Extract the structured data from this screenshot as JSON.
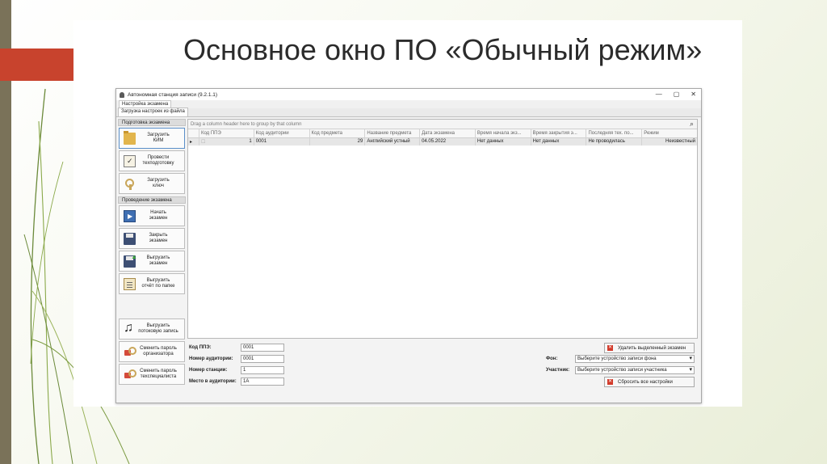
{
  "slide": {
    "title": "Основное окно ПО «Обычный режим»"
  },
  "window": {
    "title": "Автономная станция записи (9.2.1.1)",
    "controls": {
      "minimize": "—",
      "maximize": "▢",
      "close": "✕"
    },
    "menu_tab": "Настройка экзамена",
    "sub_tab": "Загрузка настроек из файла"
  },
  "left_panel": {
    "group_prepare": "Подготовка экзамена",
    "group_conduct": "Проведение экзамена",
    "buttons": {
      "load_kim": "Загрузить\nКИМ",
      "tech_prep": "Провести\nтехподготовку",
      "load_key": "Загрузить\nключ",
      "start_exam": "Начать\nэкзамен",
      "close_exam": "Закрыть\nэкзамен",
      "upload_exam": "Выгрузить\nэкзамен",
      "upload_report": "Выгрузить\nотчёт по папке",
      "upload_stream": "Выгрузить\nпотоковую запись",
      "change_org_pwd": "Сменить пароль\nорганизатора",
      "change_tech_pwd": "Сменить пароль\nтехспециалиста"
    }
  },
  "grid": {
    "group_hint": "Drag a column header here to group by that column",
    "search_icon": "⌕",
    "columns": [
      "",
      "Код ППЭ",
      "Код аудитории",
      "Код предмета",
      "Название предмета",
      "Дата экзамена",
      "Время начала экз...",
      "Время закрытия э...",
      "Последняя тех. по...",
      "Режим"
    ],
    "rows": [
      {
        "indicator": "▸",
        "check": "☐",
        "ppe_code": "1",
        "auditorium_code": "0001",
        "subject_code": "29",
        "subject_name": "Английский устный",
        "exam_date": "04.05.2022",
        "start_time": "Нет данных",
        "close_time": "Нет данных",
        "last_tech": "Не проводилась",
        "mode": "Неизвестный"
      }
    ]
  },
  "form": {
    "ppe_label": "Код ППЭ:",
    "ppe_value": "0001",
    "auditorium_label": "Номер аудитории:",
    "auditorium_value": "0001",
    "station_label": "Номер станции:",
    "station_value": "1",
    "seat_label": "Место в аудитории:",
    "seat_value": "1А",
    "bg_label": "Фон:",
    "bg_select": "Выберите устройство записи фона",
    "participant_label": "Участник:",
    "participant_select": "Выберите устройство записи участника",
    "delete_exam_button": "Удалить выделенный экзамен",
    "reset_button": "Сбросить все настройки",
    "x_icon": "✕"
  }
}
